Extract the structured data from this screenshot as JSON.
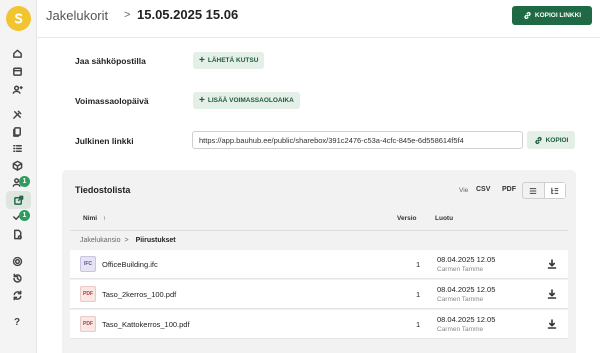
{
  "header": {
    "parent_crumb": "Jakelukorit",
    "separator": ">",
    "title": "15.05.2025 15.06",
    "more_icon": "⋮",
    "copy_link_button": "KOPIOI LINKKI"
  },
  "sidebar": {
    "logo": "bauhub-logo",
    "items": [
      {
        "icon": "home-icon"
      },
      {
        "icon": "calendar-icon"
      },
      {
        "icon": "contacts-icon"
      },
      {
        "icon": "tools-icon"
      },
      {
        "icon": "documents-icon"
      },
      {
        "icon": "checklist-icon"
      },
      {
        "icon": "box-icon"
      },
      {
        "icon": "user-tasks-icon",
        "badge": "1"
      },
      {
        "icon": "share-icon",
        "active": true
      },
      {
        "icon": "approval-icon",
        "badge": "1"
      },
      {
        "icon": "file-settings-icon"
      },
      {
        "icon": "settings-icon"
      },
      {
        "icon": "history-icon"
      },
      {
        "icon": "sync-icon"
      },
      {
        "icon": "help-icon",
        "text": "?"
      }
    ]
  },
  "form": {
    "email_label": "Jaa sähköpostilla",
    "send_invite_button": "LÄHETÄ KUTSU",
    "validity_label": "Voimassaolopäivä",
    "add_validity_button": "LISÄÄ VOIMASSAOLOAIKA",
    "public_link_label": "Julkinen linkki",
    "public_link_value": "https://app.bauhub.ee/public/sharebox/391c2476-c53a-4cfc-845e-6d558614f5f4",
    "copy_button": "KOPIOI",
    "plus": "+"
  },
  "files": {
    "title": "Tiedostolista",
    "export_label": "Vie",
    "export_csv": "CSV",
    "export_pdf": "PDF",
    "columns": {
      "name": "Nimi",
      "sort_icon": "↑",
      "version": "Versio",
      "created": "Luotu"
    },
    "breadcrumb": {
      "root": "Jakelukansio",
      "separator": ">",
      "current": "Piirustukset"
    },
    "rows": [
      {
        "type": "IFC",
        "name": "OfficeBuilding.ifc",
        "version": "1",
        "date": "08.04.2025 12.05",
        "user": "Carmen Tamme"
      },
      {
        "type": "PDF",
        "name": "Taso_2kerros_100.pdf",
        "version": "1",
        "date": "08.04.2025 12.05",
        "user": "Carmen Tamme"
      },
      {
        "type": "PDF",
        "name": "Taso_Kattokerros_100.pdf",
        "version": "1",
        "date": "08.04.2025 12.05",
        "user": "Carmen Tamme"
      }
    ]
  },
  "colors": {
    "primary": "#1f6a45",
    "soft": "#e3efe7",
    "badge": "#2f9c5e",
    "logo": "#f2c530"
  }
}
